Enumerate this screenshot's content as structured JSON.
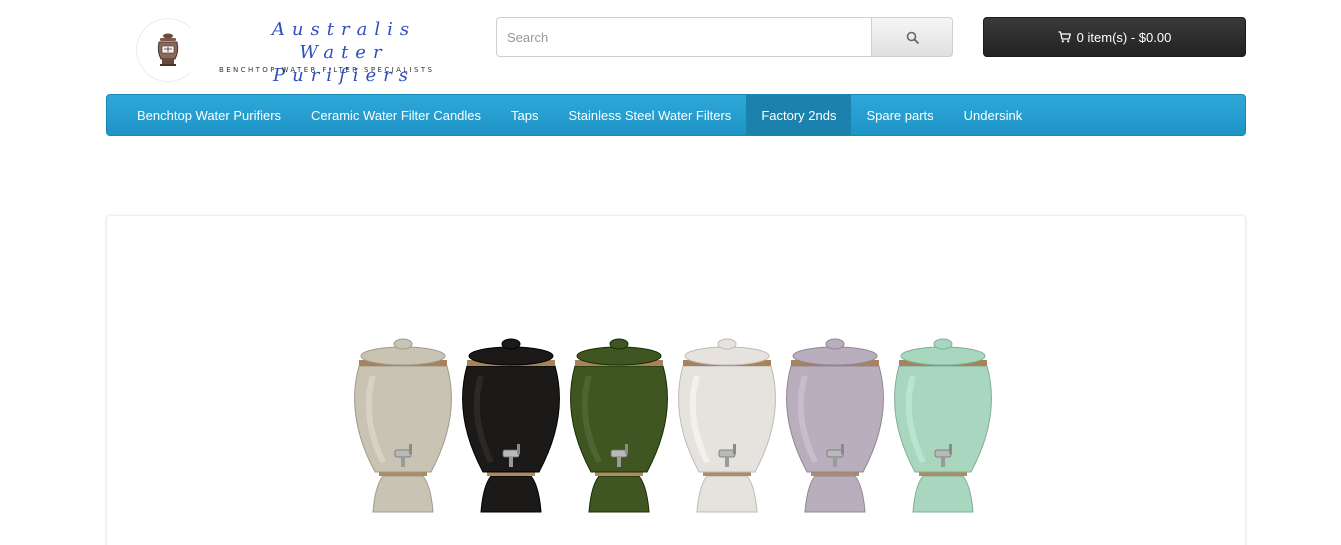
{
  "header": {
    "logo": {
      "title": "Australis Water Purifiers",
      "tagline": "BENCHTOP WATER FILTER SPECIALISTS"
    },
    "search": {
      "placeholder": "Search",
      "icon": "search-icon"
    },
    "cart": {
      "icon": "shopping-cart-icon",
      "label": "0 item(s) - $0.00"
    }
  },
  "nav": {
    "items": [
      {
        "label": "Benchtop Water Purifiers",
        "active": false
      },
      {
        "label": "Ceramic Water Filter Candles",
        "active": false
      },
      {
        "label": "Taps",
        "active": false
      },
      {
        "label": "Stainless Steel Water Filters",
        "active": false
      },
      {
        "label": "Factory 2nds",
        "active": true
      },
      {
        "label": "Spare parts",
        "active": false
      },
      {
        "label": "Undersink",
        "active": false
      }
    ]
  },
  "main": {
    "banner": {
      "image": "ceramic-water-purifier-crocks-image",
      "crock_colors": [
        "#c9c3b4",
        "#1c1a18",
        "#3f5622",
        "#e6e3de",
        "#b9aebd",
        "#a8d6bf"
      ]
    }
  },
  "colors": {
    "nav_background": "#2196c9",
    "cart_background": "#2b2b2b",
    "logo_text": "#2f4fbf"
  }
}
